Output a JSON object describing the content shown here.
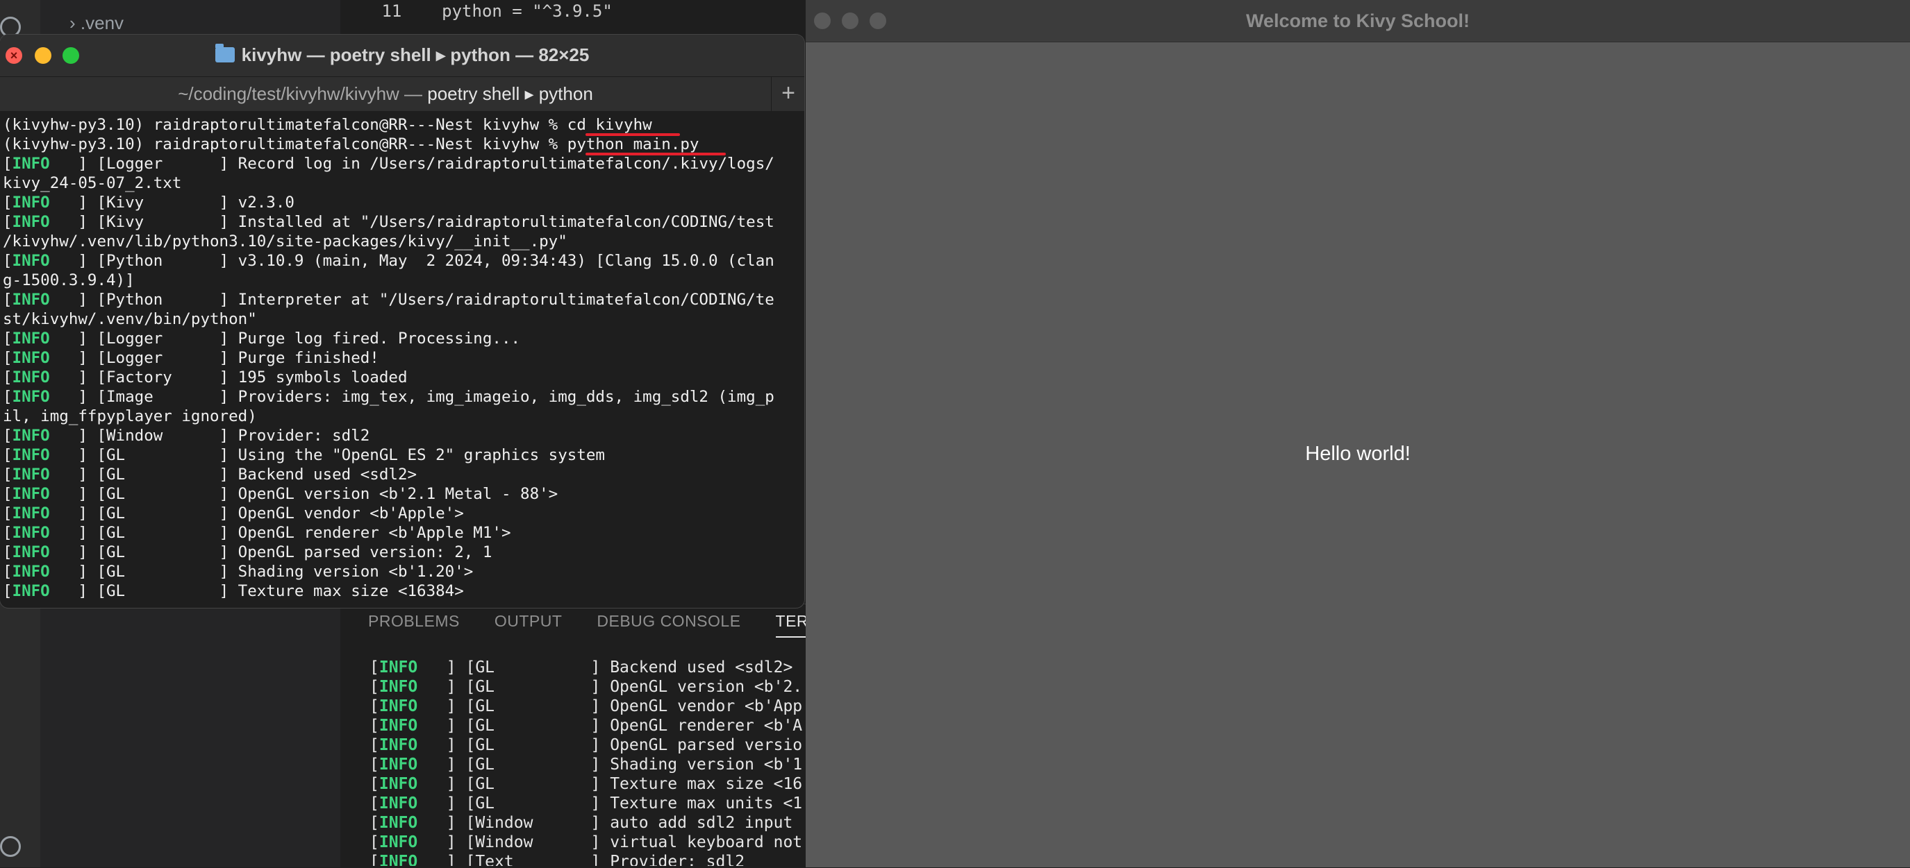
{
  "vscode": {
    "explorer_item": "› .venv",
    "editor_line": " 11    python = \"^3.9.5\"",
    "panel_tabs": [
      "PROBLEMS",
      "OUTPUT",
      "DEBUG CONSOLE",
      "TERMIN"
    ],
    "panel_lines": [
      {
        "tag": "INFO",
        "rest": "   ] [GL          ] Backend used <sdl2>"
      },
      {
        "tag": "INFO",
        "rest": "   ] [GL          ] OpenGL version <b'2."
      },
      {
        "tag": "INFO",
        "rest": "   ] [GL          ] OpenGL vendor <b'App"
      },
      {
        "tag": "INFO",
        "rest": "   ] [GL          ] OpenGL renderer <b'A"
      },
      {
        "tag": "INFO",
        "rest": "   ] [GL          ] OpenGL parsed versio"
      },
      {
        "tag": "INFO",
        "rest": "   ] [GL          ] Shading version <b'1"
      },
      {
        "tag": "INFO",
        "rest": "   ] [GL          ] Texture max size <16"
      },
      {
        "tag": "INFO",
        "rest": "   ] [GL          ] Texture max units <1"
      },
      {
        "tag": "INFO",
        "rest": "   ] [Window      ] auto add sdl2 input "
      },
      {
        "tag": "INFO",
        "rest": "   ] [Window      ] virtual keyboard not"
      },
      {
        "tag": "INFO",
        "rest": "   ] [Text        ] Provider: sdl2"
      }
    ]
  },
  "terminal": {
    "title": "kivyhw — poetry shell ▸ python — 82×25",
    "tab_path": "~/coding/test/kivyhw/kivyhw — ",
    "tab_bold": "poetry shell ▸ python",
    "new_tab": "+",
    "prompt": "(kivyhw-py3.10) raidraptorultimatefalcon@RR---Nest kivyhw % ",
    "cmd1": "cd kivyhw",
    "cmd2": "python main.py",
    "lines": [
      {
        "tag": "INFO",
        "rest": "   ] [Logger      ] Record log in /Users/raidraptorultimatefalcon/.kivy/logs/"
      },
      {
        "tag": "",
        "rest": "kivy_24-05-07_2.txt"
      },
      {
        "tag": "INFO",
        "rest": "   ] [Kivy        ] v2.3.0"
      },
      {
        "tag": "INFO",
        "rest": "   ] [Kivy        ] Installed at \"/Users/raidraptorultimatefalcon/CODING/test"
      },
      {
        "tag": "",
        "rest": "/kivyhw/.venv/lib/python3.10/site-packages/kivy/__init__.py\""
      },
      {
        "tag": "INFO",
        "rest": "   ] [Python      ] v3.10.9 (main, May  2 2024, 09:34:43) [Clang 15.0.0 (clan"
      },
      {
        "tag": "",
        "rest": "g-1500.3.9.4)]"
      },
      {
        "tag": "INFO",
        "rest": "   ] [Python      ] Interpreter at \"/Users/raidraptorultimatefalcon/CODING/te"
      },
      {
        "tag": "",
        "rest": "st/kivyhw/.venv/bin/python\""
      },
      {
        "tag": "INFO",
        "rest": "   ] [Logger      ] Purge log fired. Processing..."
      },
      {
        "tag": "INFO",
        "rest": "   ] [Logger      ] Purge finished!"
      },
      {
        "tag": "INFO",
        "rest": "   ] [Factory     ] 195 symbols loaded"
      },
      {
        "tag": "INFO",
        "rest": "   ] [Image       ] Providers: img_tex, img_imageio, img_dds, img_sdl2 (img_p"
      },
      {
        "tag": "",
        "rest": "il, img_ffpyplayer ignored)"
      },
      {
        "tag": "INFO",
        "rest": "   ] [Window      ] Provider: sdl2"
      },
      {
        "tag": "INFO",
        "rest": "   ] [GL          ] Using the \"OpenGL ES 2\" graphics system"
      },
      {
        "tag": "INFO",
        "rest": "   ] [GL          ] Backend used <sdl2>"
      },
      {
        "tag": "INFO",
        "rest": "   ] [GL          ] OpenGL version <b'2.1 Metal - 88'>"
      },
      {
        "tag": "INFO",
        "rest": "   ] [GL          ] OpenGL vendor <b'Apple'>"
      },
      {
        "tag": "INFO",
        "rest": "   ] [GL          ] OpenGL renderer <b'Apple M1'>"
      },
      {
        "tag": "INFO",
        "rest": "   ] [GL          ] OpenGL parsed version: 2, 1"
      },
      {
        "tag": "INFO",
        "rest": "   ] [GL          ] Shading version <b'1.20'>"
      },
      {
        "tag": "INFO",
        "rest": "   ] [GL          ] Texture max size <16384>"
      }
    ]
  },
  "kivy": {
    "title": "Welcome to Kivy School!",
    "label": "Hello world!"
  },
  "colors": {
    "info_green": "#3fd57f",
    "annotation_red": "#e5202c",
    "kivy_bg": "#595959"
  }
}
